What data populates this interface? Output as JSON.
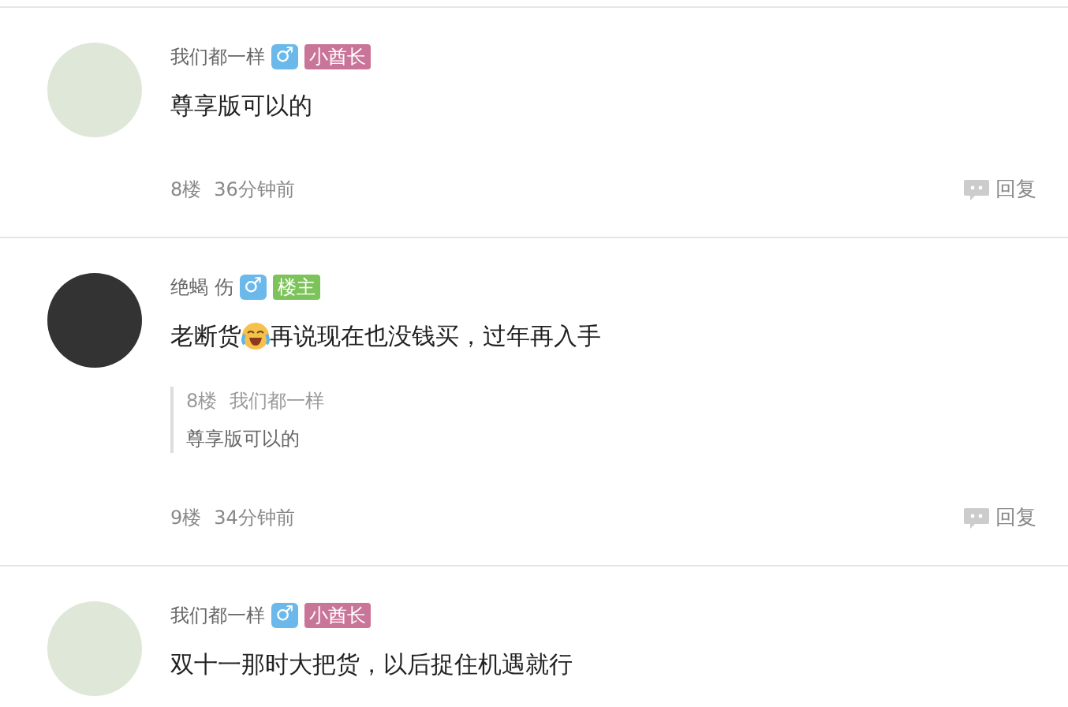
{
  "comments": [
    {
      "user": "我们都一样",
      "gender": "♂",
      "badge": {
        "text": "小酋长",
        "color": "#c9759a"
      },
      "content": [
        {
          "kind": "text",
          "text": "尊享版可以的"
        }
      ],
      "floor": "8楼",
      "time": "36分钟前",
      "reply": "回复"
    },
    {
      "user": "绝蝎 伤",
      "gender": "♂",
      "badge": {
        "text": "楼主",
        "color": "#7cc35a"
      },
      "content": [
        {
          "kind": "text",
          "text": "老断货"
        },
        {
          "kind": "emoji"
        },
        {
          "kind": "text",
          "text": "再说现在也没钱买，过年再入手"
        }
      ],
      "quote": {
        "floor": "8楼",
        "user": "我们都一样",
        "text": "尊享版可以的"
      },
      "floor": "9楼",
      "time": "34分钟前",
      "reply": "回复"
    },
    {
      "user": "我们都一样",
      "gender": "♂",
      "badge": {
        "text": "小酋长",
        "color": "#c9759a"
      },
      "content": [
        {
          "kind": "text",
          "text": "双十一那时大把货，以后捉住机遇就行"
        }
      ]
    }
  ]
}
